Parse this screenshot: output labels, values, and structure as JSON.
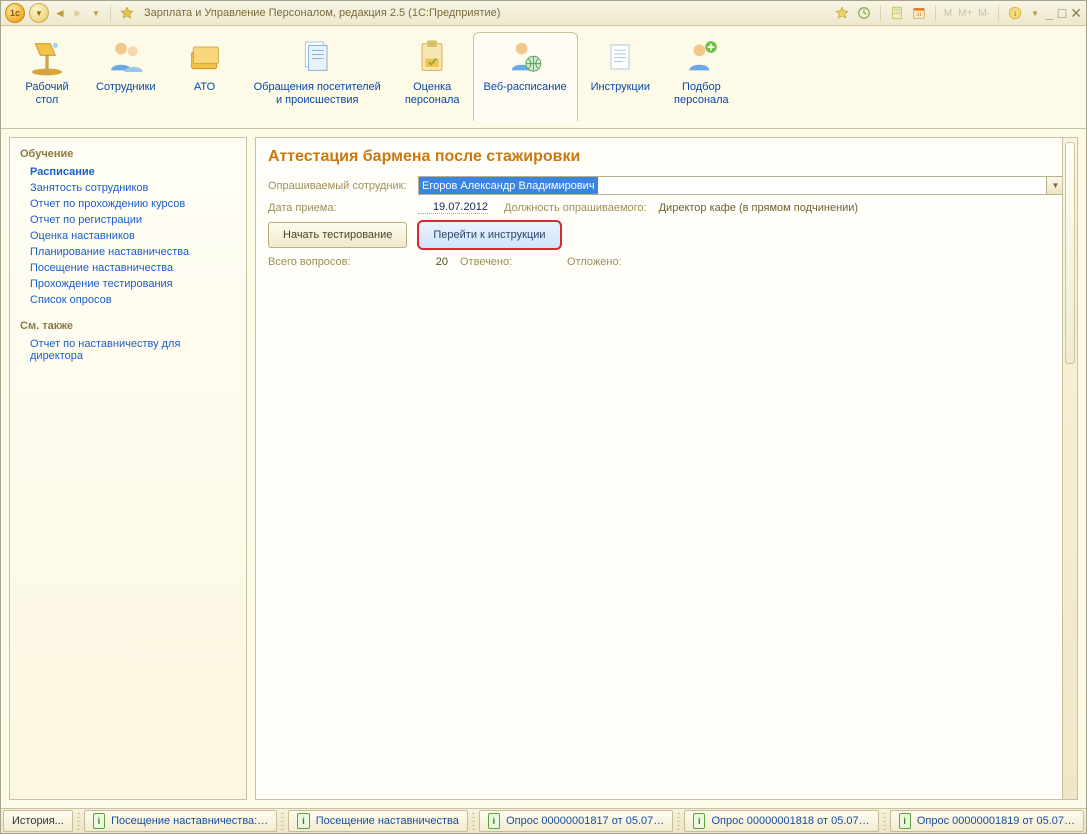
{
  "window": {
    "title": "Зарплата и Управление Персоналом, редакция 2.5  (1С:Предприятие)"
  },
  "titlebar_icons": {
    "m": "M",
    "mplus": "M+",
    "mminus": "M-"
  },
  "ribbon": {
    "tabs": [
      {
        "label": "Рабочий\nстол"
      },
      {
        "label": "Сотрудники"
      },
      {
        "label": "АТО"
      },
      {
        "label": "Обращения посетителей\nи происшествия"
      },
      {
        "label": "Оценка\nперсонала"
      },
      {
        "label": "Веб-расписание"
      },
      {
        "label": "Инструкции"
      },
      {
        "label": "Подбор\nперсонала"
      }
    ]
  },
  "sidebar": {
    "sections": [
      {
        "title": "Обучение",
        "items": [
          {
            "label": "Расписание",
            "bold": true
          },
          {
            "label": "Занятость сотрудников"
          },
          {
            "label": "Отчет по прохождению курсов"
          },
          {
            "label": "Отчет по регистрации"
          },
          {
            "label": "Оценка наставников"
          },
          {
            "label": "Планирование наставничества"
          },
          {
            "label": "Посещение наставничества"
          },
          {
            "label": "Прохождение тестирования"
          },
          {
            "label": "Список опросов"
          }
        ]
      },
      {
        "title": "См. также",
        "items": [
          {
            "label": "Отчет по наставничеству для директора"
          }
        ]
      }
    ]
  },
  "page": {
    "title": "Аттестация бармена после стажировки",
    "employee_label": "Опрашиваемый сотрудник:",
    "employee_value": "Егоров Александр Владимирович",
    "hire_label": "Дата приема:",
    "hire_value": "19.07.2012",
    "pos_label": "Должность опрашиваемого:",
    "pos_value": "Директор кафе (в прямом подчинении)",
    "btn_start": "Начать тестирование",
    "btn_instr": "Перейти к инструкции",
    "total_q_label": "Всего вопросов:",
    "total_q_value": "20",
    "answered_label": "Отвечено:",
    "deferred_label": "Отложено:"
  },
  "taskbar": {
    "history": "История...",
    "tabs": [
      "Посещение наставничества:…",
      "Посещение наставничества",
      "Опрос 00000001817 от 05.07…",
      "Опрос 00000001818 от 05.07…",
      "Опрос 00000001819 от 05.07…"
    ]
  }
}
